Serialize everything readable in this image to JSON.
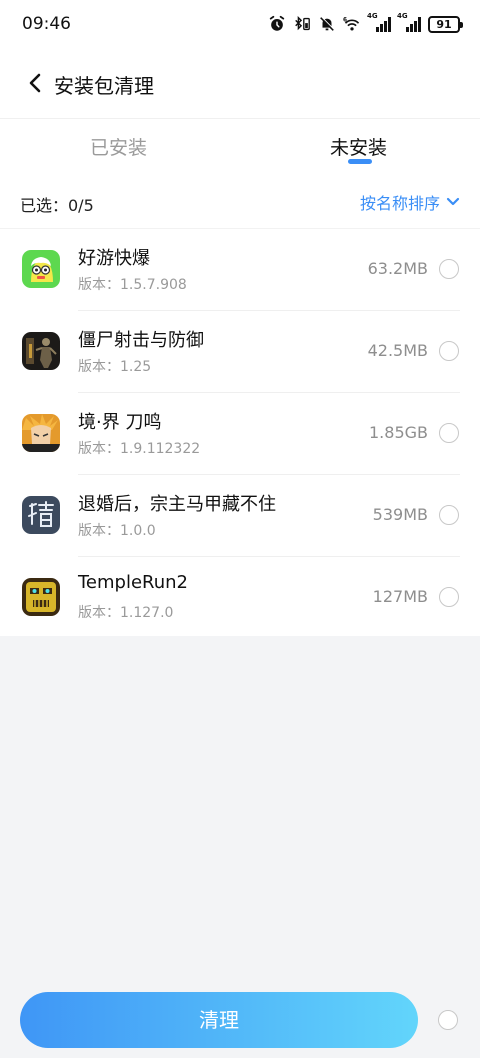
{
  "status_bar": {
    "time": "09:46",
    "signal_label_1": "4G",
    "signal_label_2": "4G",
    "wifi_label": "6",
    "battery": "91"
  },
  "header": {
    "title": "安装包清理"
  },
  "tabs": [
    {
      "label": "已安装",
      "active": false
    },
    {
      "label": "未安装",
      "active": true
    }
  ],
  "selection": {
    "count_text": "已选：0/5",
    "sort_label": "按名称排序"
  },
  "apps": [
    {
      "name": "好游快爆",
      "version": "版本：1.5.7.908",
      "size": "63.2MB",
      "icon": "haoyou-kuaibao-icon"
    },
    {
      "name": "僵尸射击与防御",
      "version": "版本：1.25",
      "size": "42.5MB",
      "icon": "zombie-shooter-icon"
    },
    {
      "name": "境·界 刀鸣",
      "version": "版本：1.9.112322",
      "size": "1.85GB",
      "icon": "bleach-icon"
    },
    {
      "name": "退婚后，宗主马甲藏不住",
      "version": "版本：1.0.0",
      "size": "539MB",
      "icon": "hun-character-icon"
    },
    {
      "name": "TempleRun2",
      "version": "版本：1.127.0",
      "size": "127MB",
      "icon": "temple-run-icon"
    }
  ],
  "footer": {
    "clean_label": "清理"
  },
  "colors": {
    "accent": "#3a8ef6",
    "button_start": "#3f96f6",
    "button_end": "#62d5fb"
  }
}
